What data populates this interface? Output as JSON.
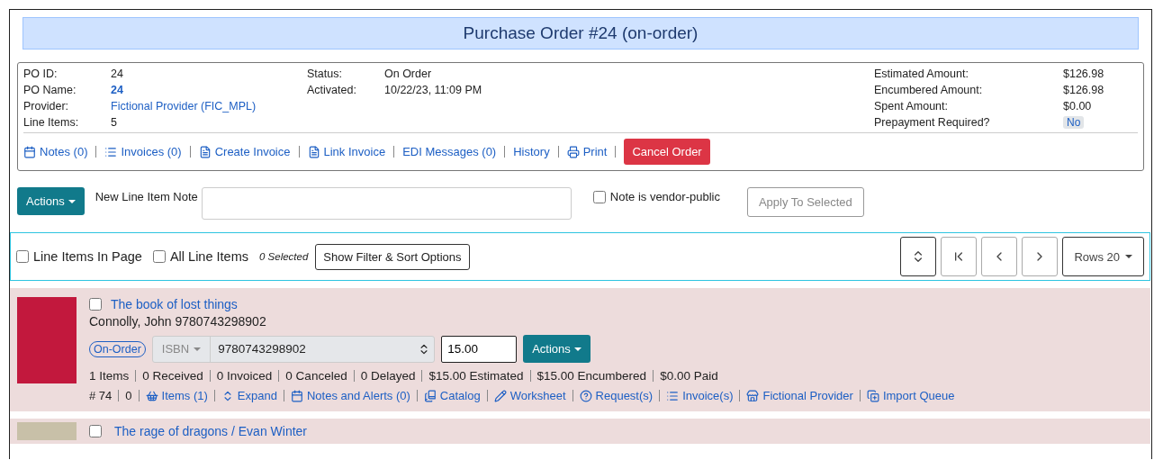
{
  "title": "Purchase Order #24 (on-order)",
  "summary": {
    "left": [
      {
        "label": "PO ID:",
        "value": "24",
        "kind": "text"
      },
      {
        "label": "PO Name:",
        "value": "24",
        "kind": "bold-link"
      },
      {
        "label": "Provider:",
        "value": "Fictional Provider (FIC_MPL)",
        "kind": "link"
      },
      {
        "label": "Line Items:",
        "value": "5",
        "kind": "text"
      }
    ],
    "middle": [
      {
        "label": "Status:",
        "value": "On Order",
        "kind": "text"
      },
      {
        "label": "Activated:",
        "value": "10/22/23, 11:09 PM",
        "kind": "text"
      }
    ],
    "right": [
      {
        "label": "Estimated Amount:",
        "value": "$126.98",
        "kind": "text"
      },
      {
        "label": "Encumbered Amount:",
        "value": "$126.98",
        "kind": "text"
      },
      {
        "label": "Spent Amount:",
        "value": "$0.00",
        "kind": "text"
      },
      {
        "label": "Prepayment Required?",
        "value": "No",
        "kind": "badge"
      }
    ],
    "links": [
      "Notes (0)",
      "Invoices (0)",
      "Create Invoice",
      "Link Invoice",
      "EDI Messages (0)",
      "History",
      "Print"
    ],
    "cancel_button": "Cancel Order"
  },
  "note_bar": {
    "actions_button": "Actions",
    "note_label": "New Line Item Note",
    "vendor_public": {
      "label": "Note is vendor-public",
      "checked": false
    },
    "apply_button": {
      "label": "Apply To Selected",
      "disabled": true
    }
  },
  "toolbar": {
    "checkboxes": [
      {
        "label": "Line Items In Page",
        "checked": false
      },
      {
        "label": "All Line Items",
        "checked": false
      }
    ],
    "selected_count": "0 Selected",
    "filter_button": "Show Filter & Sort Options",
    "rows_button": "Rows 20"
  },
  "line_items": [
    {
      "checked": false,
      "title": "The book of lost things",
      "author_isbn": "Connolly, John 9780743298902",
      "status": "On-Order",
      "id_type": "ISBN",
      "identifier": "9780743298902",
      "price": "15.00",
      "actions": "Actions",
      "stats": [
        "1 Items",
        "0 Received",
        "0 Invoiced",
        "0 Canceled",
        "0 Delayed",
        "$15.00 Estimated",
        "$15.00 Encumbered",
        "$0.00 Paid"
      ],
      "number": "# 74",
      "count": "0",
      "links": [
        "Items (1)",
        "Expand",
        "Notes and Alerts (0)",
        "Catalog",
        "Worksheet",
        "Request(s)",
        "Invoice(s)",
        "Fictional Provider",
        "Import Queue"
      ]
    },
    {
      "checked": false,
      "title": "The rage of dragons / Evan Winter"
    }
  ]
}
